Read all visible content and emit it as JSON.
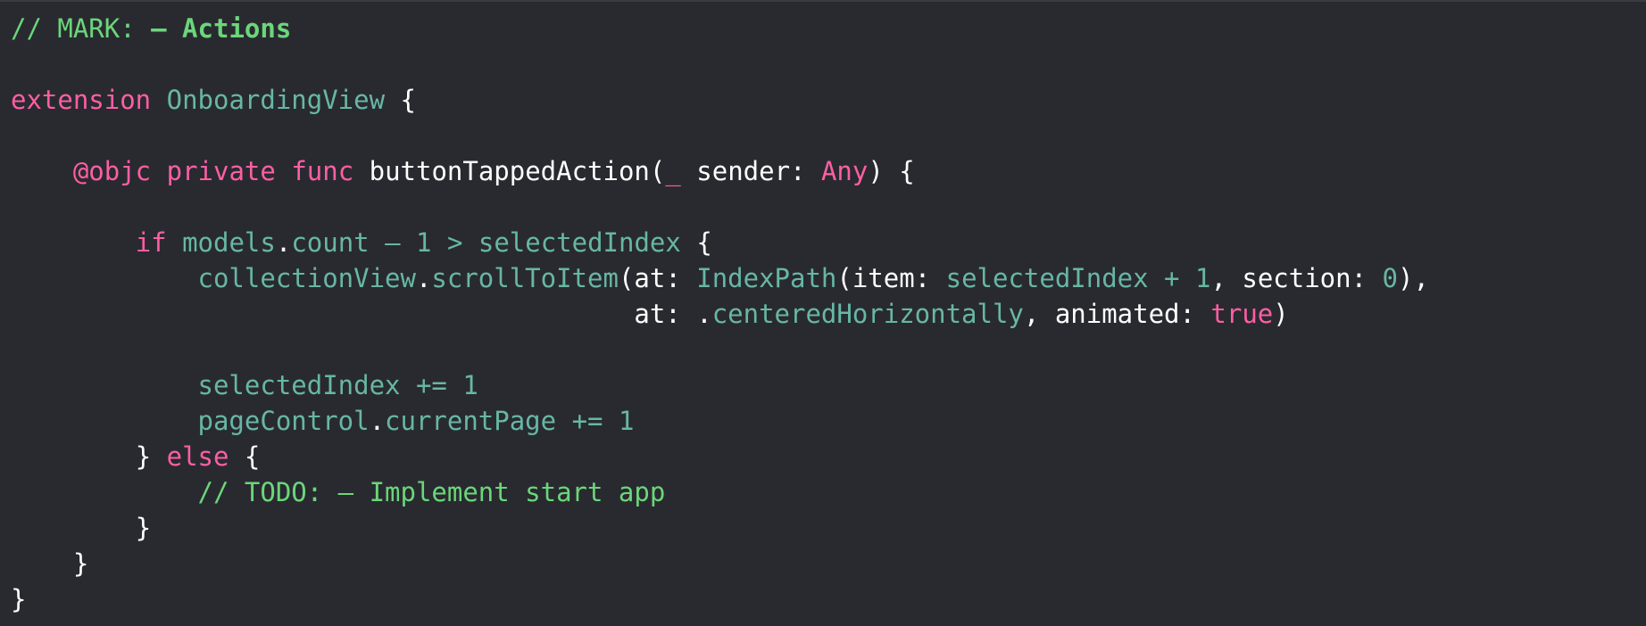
{
  "editor": {
    "lines": [
      {
        "indent": "",
        "tokens": [
          {
            "t": "// MARK: ",
            "k": "mark"
          },
          {
            "t": "– Actions",
            "k": "markbold"
          }
        ]
      },
      {
        "indent": "",
        "tokens": []
      },
      {
        "indent": "",
        "tokens": [
          {
            "t": "extension",
            "k": "keyword"
          },
          {
            "t": " ",
            "k": "plain"
          },
          {
            "t": "OnboardingView",
            "k": "cls"
          },
          {
            "t": " {",
            "k": "plain"
          }
        ]
      },
      {
        "indent": "",
        "tokens": []
      },
      {
        "indent": "    ",
        "tokens": [
          {
            "t": "@objc",
            "k": "attr"
          },
          {
            "t": " ",
            "k": "plain"
          },
          {
            "t": "private",
            "k": "keyword"
          },
          {
            "t": " ",
            "k": "plain"
          },
          {
            "t": "func",
            "k": "keyword"
          },
          {
            "t": " buttonTappedAction(",
            "k": "plain"
          },
          {
            "t": "_",
            "k": "keyword"
          },
          {
            "t": " sender: ",
            "k": "plain"
          },
          {
            "t": "Any",
            "k": "keyword"
          },
          {
            "t": ") {",
            "k": "plain"
          }
        ]
      },
      {
        "indent": "",
        "tokens": []
      },
      {
        "indent": "        ",
        "tokens": [
          {
            "t": "if",
            "k": "keyword"
          },
          {
            "t": " ",
            "k": "plain"
          },
          {
            "t": "models",
            "k": "ident"
          },
          {
            "t": ".",
            "k": "plain"
          },
          {
            "t": "count",
            "k": "member"
          },
          {
            "t": " – ",
            "k": "member"
          },
          {
            "t": "1",
            "k": "number"
          },
          {
            "t": " > ",
            "k": "member"
          },
          {
            "t": "selectedIndex",
            "k": "ident"
          },
          {
            "t": " {",
            "k": "plain"
          }
        ]
      },
      {
        "indent": "            ",
        "tokens": [
          {
            "t": "collectionView",
            "k": "ident"
          },
          {
            "t": ".",
            "k": "plain"
          },
          {
            "t": "scrollToItem",
            "k": "member"
          },
          {
            "t": "(at: ",
            "k": "plain"
          },
          {
            "t": "IndexPath",
            "k": "cls"
          },
          {
            "t": "(item: ",
            "k": "plain"
          },
          {
            "t": "selectedIndex",
            "k": "ident"
          },
          {
            "t": " + ",
            "k": "member"
          },
          {
            "t": "1",
            "k": "number"
          },
          {
            "t": ", section: ",
            "k": "plain"
          },
          {
            "t": "0",
            "k": "number"
          },
          {
            "t": "),",
            "k": "plain"
          }
        ]
      },
      {
        "indent": "                                        ",
        "tokens": [
          {
            "t": "at: .",
            "k": "plain"
          },
          {
            "t": "centeredHorizontally",
            "k": "member"
          },
          {
            "t": ", animated: ",
            "k": "plain"
          },
          {
            "t": "true",
            "k": "keyword"
          },
          {
            "t": ")",
            "k": "plain"
          }
        ]
      },
      {
        "indent": "",
        "tokens": []
      },
      {
        "indent": "            ",
        "tokens": [
          {
            "t": "selectedIndex",
            "k": "ident"
          },
          {
            "t": " += ",
            "k": "member"
          },
          {
            "t": "1",
            "k": "number"
          }
        ]
      },
      {
        "indent": "            ",
        "tokens": [
          {
            "t": "pageControl",
            "k": "ident"
          },
          {
            "t": ".",
            "k": "plain"
          },
          {
            "t": "currentPage",
            "k": "member"
          },
          {
            "t": " += ",
            "k": "member"
          },
          {
            "t": "1",
            "k": "number"
          }
        ]
      },
      {
        "indent": "        ",
        "tokens": [
          {
            "t": "} ",
            "k": "plain"
          },
          {
            "t": "else",
            "k": "keyword"
          },
          {
            "t": " {",
            "k": "plain"
          }
        ]
      },
      {
        "indent": "            ",
        "tokens": [
          {
            "t": "// TODO: – Implement start app",
            "k": "todo"
          }
        ]
      },
      {
        "indent": "        ",
        "tokens": [
          {
            "t": "}",
            "k": "plain"
          }
        ]
      },
      {
        "indent": "    ",
        "tokens": [
          {
            "t": "}",
            "k": "plain"
          }
        ]
      },
      {
        "indent": "",
        "tokens": [
          {
            "t": "}",
            "k": "plain"
          }
        ]
      }
    ]
  }
}
